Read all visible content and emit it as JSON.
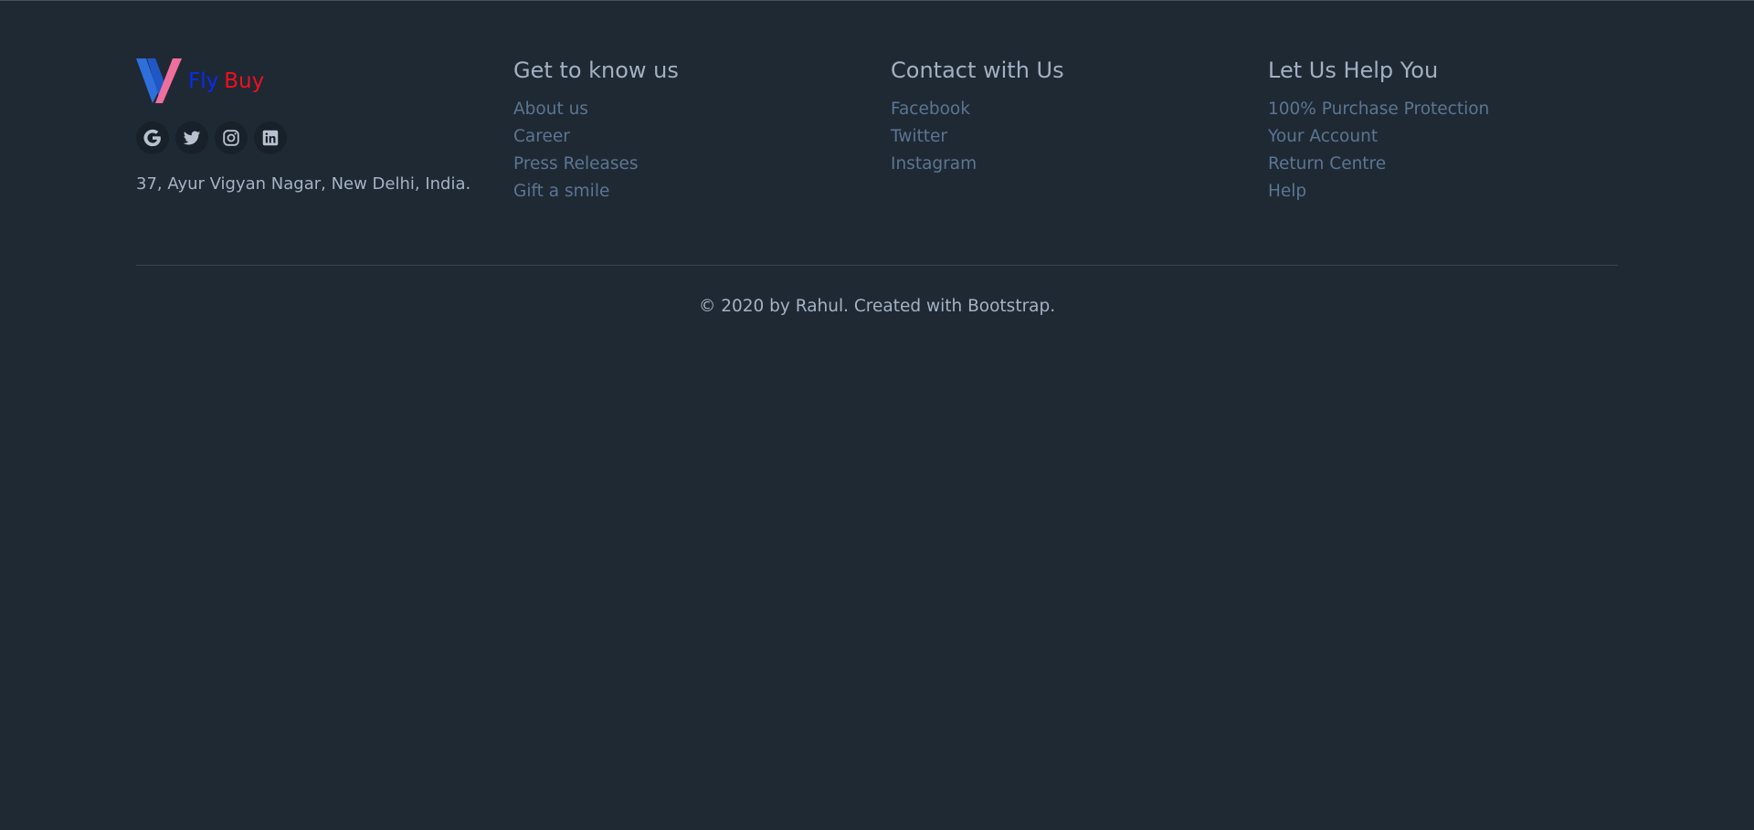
{
  "brand": {
    "name_part1": "Fly",
    "name_part2": "Buy",
    "color_part1": "#0a2bf0",
    "color_part2": "#f0101e",
    "logo_icon": "v-logo-icon"
  },
  "socials": [
    {
      "icon": "google-icon"
    },
    {
      "icon": "twitter-icon"
    },
    {
      "icon": "instagram-icon"
    },
    {
      "icon": "linkedin-icon"
    }
  ],
  "address": "37, Ayur Vigyan Nagar, New Delhi, India.",
  "columns": [
    {
      "heading": "Get to know us",
      "links": [
        "About us",
        "Career",
        "Press Releases",
        "Gift a smile"
      ]
    },
    {
      "heading": "Contact with Us",
      "links": [
        "Facebook",
        "Twitter",
        "Instagram"
      ]
    },
    {
      "heading": "Let Us Help You",
      "links": [
        "100% Purchase Protection",
        "Your Account",
        "Return Centre",
        "Help"
      ]
    }
  ],
  "copyright": "© 2020 by Rahul. Created with Bootstrap.",
  "colors": {
    "background": "#1f2934",
    "link": "#5c7591",
    "heading": "#a2b0c2"
  }
}
